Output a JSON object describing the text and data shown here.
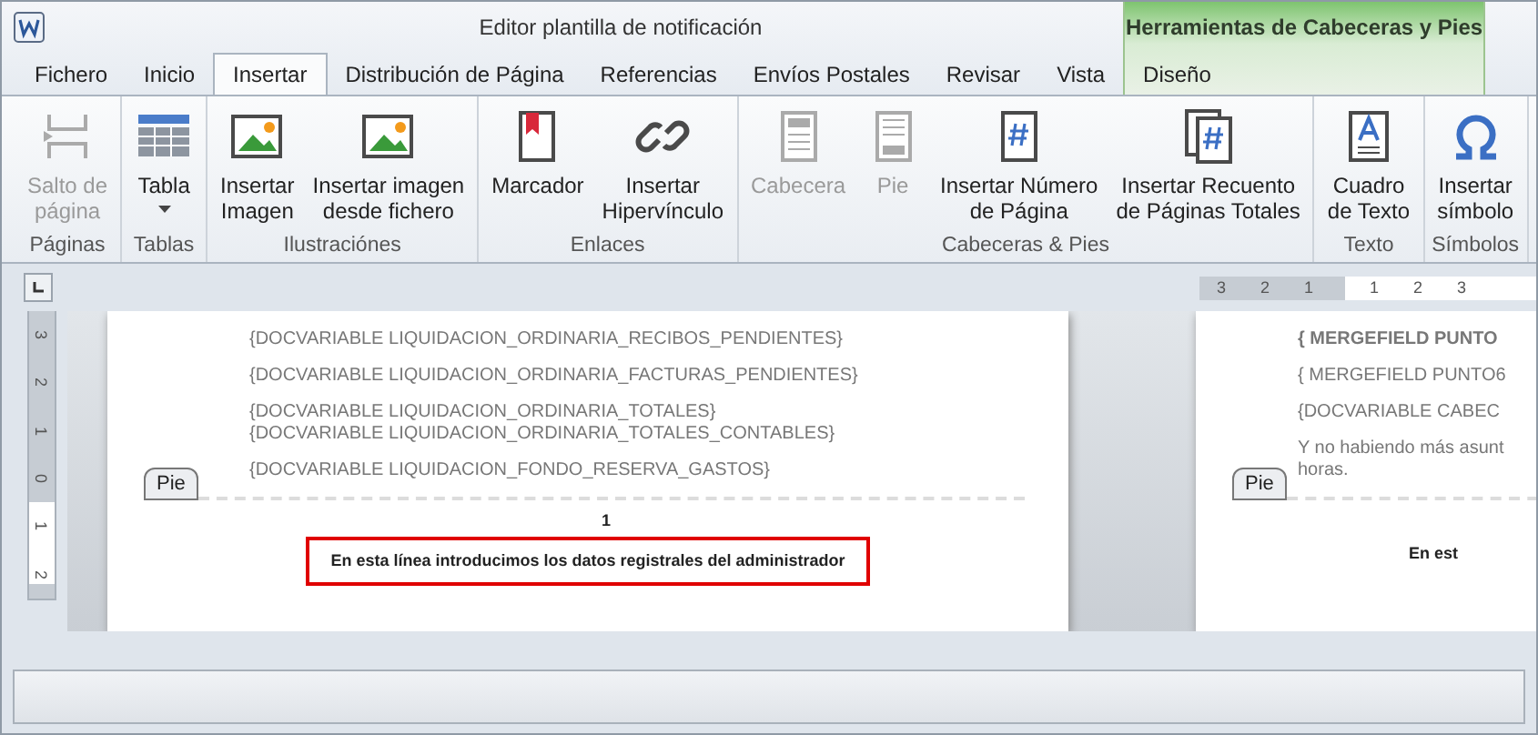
{
  "window": {
    "title": "Editor plantilla de notificación",
    "context_tab": "Herramientas de Cabeceras y Pies"
  },
  "tabs": [
    {
      "label": "Fichero",
      "selected": false
    },
    {
      "label": "Inicio",
      "selected": false
    },
    {
      "label": "Insertar",
      "selected": true
    },
    {
      "label": "Distribución de Página",
      "selected": false
    },
    {
      "label": "Referencias",
      "selected": false
    },
    {
      "label": "Envíos Postales",
      "selected": false
    },
    {
      "label": "Revisar",
      "selected": false
    },
    {
      "label": "Vista",
      "selected": false
    },
    {
      "label": "Diseño",
      "selected": false,
      "kind": "context"
    }
  ],
  "ribbon": [
    {
      "label": "Páginas",
      "items": [
        {
          "label": [
            "Salto de",
            "página"
          ],
          "disabled": true
        }
      ]
    },
    {
      "label": "Tablas",
      "items": [
        {
          "label": [
            "Tabla"
          ],
          "disabled": false,
          "dropdown": true
        }
      ]
    },
    {
      "label": "Ilustraciónes",
      "items": [
        {
          "label": [
            "Insertar",
            "Imagen"
          ],
          "disabled": false
        },
        {
          "label": [
            "Insertar imagen",
            "desde fichero"
          ],
          "disabled": false
        }
      ]
    },
    {
      "label": "Enlaces",
      "items": [
        {
          "label": [
            "Marcador"
          ],
          "disabled": false
        },
        {
          "label": [
            "Insertar",
            "Hipervínculo"
          ],
          "disabled": false
        }
      ]
    },
    {
      "label": "Cabeceras & Pies",
      "items": [
        {
          "label": [
            "Cabecera"
          ],
          "disabled": true
        },
        {
          "label": [
            "Pie"
          ],
          "disabled": true
        },
        {
          "label": [
            "Insertar Número",
            "de Página"
          ],
          "disabled": false
        },
        {
          "label": [
            "Insertar Recuento",
            "de Páginas Totales"
          ],
          "disabled": false
        }
      ]
    },
    {
      "label": "Texto",
      "items": [
        {
          "label": [
            "Cuadro",
            "de Texto"
          ],
          "disabled": false
        }
      ]
    },
    {
      "label": "Símbolos",
      "items": [
        {
          "label": [
            "Insertar",
            "símbolo"
          ],
          "disabled": false
        }
      ]
    }
  ],
  "ruler": {
    "horizontal": [
      "3",
      "2",
      "1",
      "1",
      "2",
      "3"
    ],
    "vertical": [
      "3",
      "2",
      "1",
      "0",
      "1",
      "2"
    ]
  },
  "pages": [
    {
      "paragraphs": [
        [
          {
            "text": "{DOCVARIABLE LIQUIDACION_ORDINARIA_RECIBOS_PENDIENTES}",
            "bold": false
          }
        ],
        [
          {
            "text": "{DOCVARIABLE LIQUIDACION_ORDINARIA_FACTURAS_PENDIENTES}",
            "bold": false
          }
        ],
        [
          {
            "text": "{DOCVARIABLE LIQUIDACION_ORDINARIA_TOTALES}",
            "bold": false
          },
          {
            "text": "{DOCVARIABLE LIQUIDACION_ORDINARIA_TOTALES_CONTABLES}",
            "bold": false
          }
        ],
        [
          {
            "text": "{DOCVARIABLE LIQUIDACION_FONDO_RESERVA_GASTOS}",
            "bold": false
          }
        ]
      ],
      "footer_tag": "Pie",
      "page_number": "1",
      "footer_text": "En esta línea introducimos los datos registrales del administrador",
      "highlighted": true
    },
    {
      "paragraphs": [
        [
          {
            "text": "{ MERGEFIELD PUNTO",
            "bold": true
          }
        ],
        [
          {
            "text": "{ MERGEFIELD PUNTO6",
            "bold": false
          }
        ],
        [
          {
            "text": "{DOCVARIABLE CABEC",
            "bold": false
          }
        ],
        [
          {
            "text": "Y no habiendo más asunt",
            "bold": false
          },
          {
            "text": "horas.",
            "bold": false
          }
        ]
      ],
      "footer_tag": "Pie",
      "footer_text": "En est",
      "highlighted": false
    }
  ]
}
